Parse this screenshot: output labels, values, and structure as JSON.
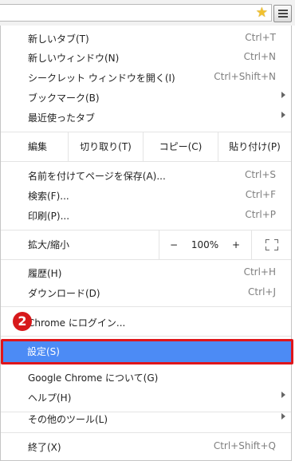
{
  "toolbar": {
    "star_icon": "star-icon",
    "menu_icon": "hamburger-menu-icon"
  },
  "menu": {
    "group1": [
      {
        "label": "新しいタブ(T)",
        "shortcut": "Ctrl+T"
      },
      {
        "label": "新しいウィンドウ(N)",
        "shortcut": "Ctrl+N"
      },
      {
        "label": "シークレット ウィンドウを開く(I)",
        "shortcut": "Ctrl+Shift+N"
      },
      {
        "label": "ブックマーク(B)",
        "submenu": true
      },
      {
        "label": "最近使ったタブ",
        "submenu": true
      }
    ],
    "edit": {
      "label": "編集",
      "cut": "切り取り(T)",
      "copy": "コピー(C)",
      "paste": "貼り付け(P)"
    },
    "group2": [
      {
        "label": "名前を付けてページを保存(A)...",
        "shortcut": "Ctrl+S"
      },
      {
        "label": "検索(F)...",
        "shortcut": "Ctrl+F"
      },
      {
        "label": "印刷(P)...",
        "shortcut": "Ctrl+P"
      }
    ],
    "zoom": {
      "label": "拡大/縮小",
      "minus": "−",
      "value": "100%",
      "plus": "+"
    },
    "group3": [
      {
        "label": "履歴(H)",
        "shortcut": "Ctrl+H"
      },
      {
        "label": "ダウンロード(D)",
        "shortcut": "Ctrl+J"
      }
    ],
    "signin": "Chrome にログイン...",
    "group4": [
      {
        "label": "設定(S)"
      },
      {
        "label": "Google Chrome について(G)"
      },
      {
        "label": "ヘルプ(H)",
        "submenu": true
      }
    ],
    "more_tools": {
      "label": "その他のツール(L)",
      "submenu": true
    },
    "exit": {
      "label": "終了(X)",
      "shortcut": "Ctrl+Shift+Q"
    }
  },
  "annotation": {
    "step": "2",
    "highlight_color": "#e0161b",
    "selection_color": "#4c8bf5"
  }
}
